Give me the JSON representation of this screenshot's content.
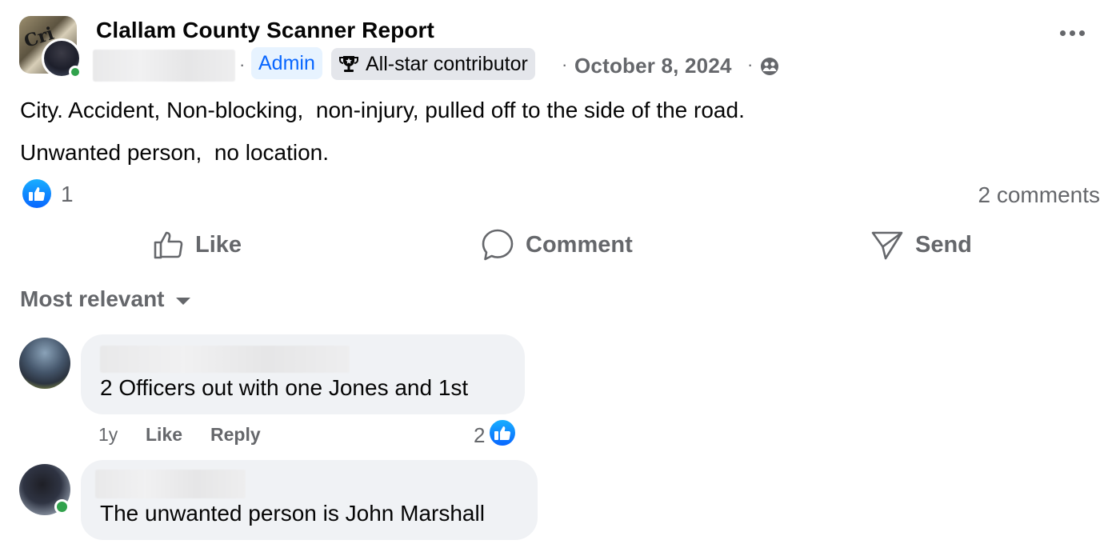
{
  "post": {
    "group_name": "Clallam County Scanner Report",
    "group_avatar_text": "Cri",
    "badges": {
      "admin": "Admin",
      "allstar": "All-star contributor"
    },
    "separator": "·",
    "date": "October 8, 2024",
    "audience_icon": "group-audience-icon",
    "text_line_1": "City. Accident, Non-blocking,  non-injury, pulled off to the side of the road.",
    "text_line_2": "Unwanted person,  no location.",
    "reaction_count": "1",
    "comments_count": "2 comments"
  },
  "actions": {
    "like": "Like",
    "comment": "Comment",
    "send": "Send"
  },
  "comments_section": {
    "sort_label": "Most relevant",
    "comments": [
      {
        "text": "2 Officers out with one Jones and 1st",
        "age": "1y",
        "like_label": "Like",
        "reply_label": "Reply",
        "like_count": "2"
      },
      {
        "text": "The unwanted person is John Marshall"
      }
    ]
  },
  "colors": {
    "accent": "#0866ff",
    "online": "#31a24c",
    "muted": "#65676b",
    "bubble": "#f0f2f5"
  }
}
